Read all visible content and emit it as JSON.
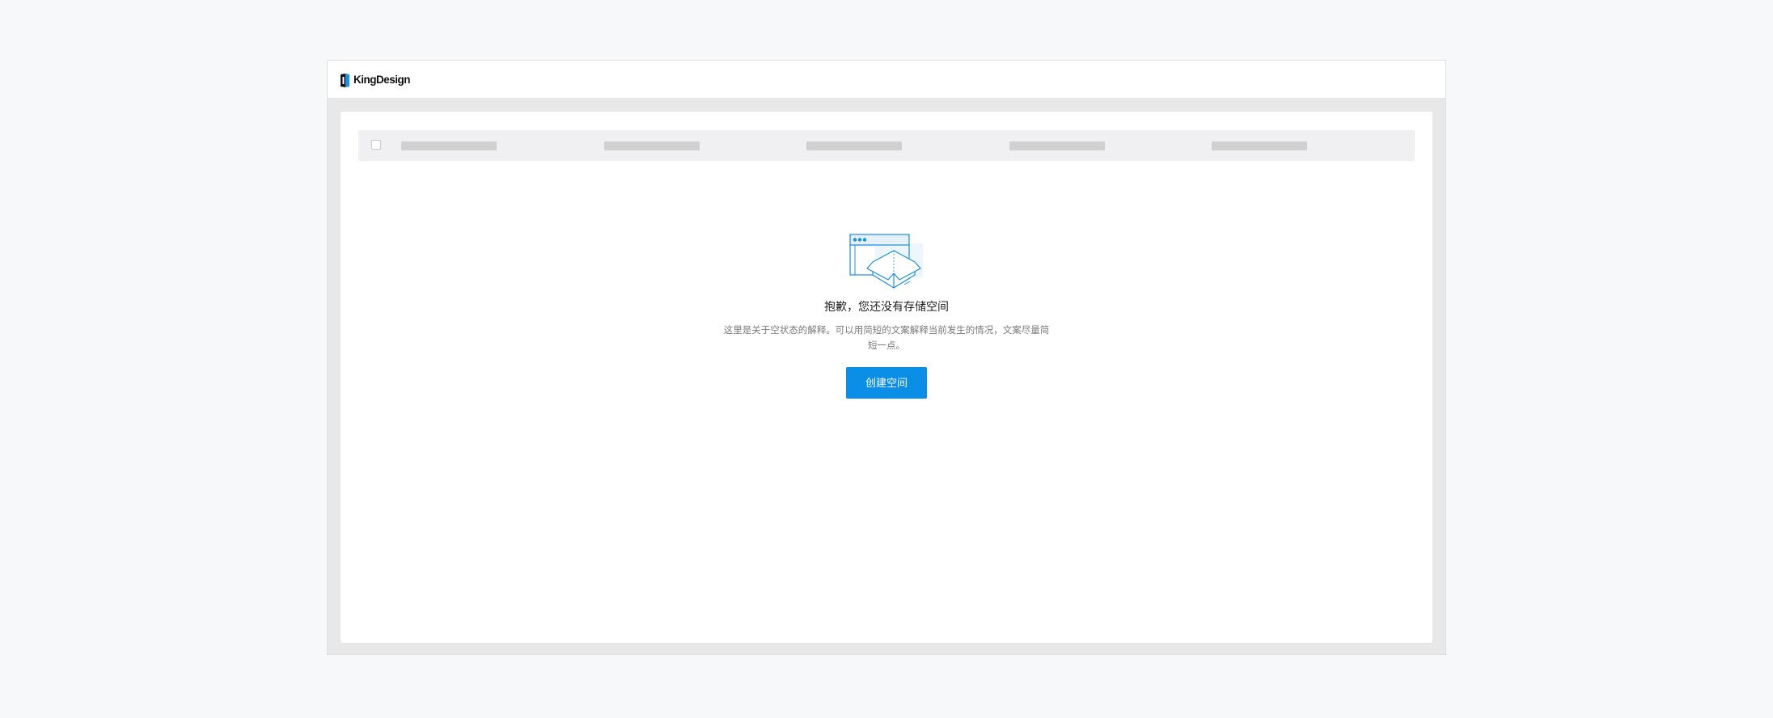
{
  "app": {
    "brand_name": "KingDesign",
    "logo_icon": "kingdesign-logo-icon"
  },
  "table": {
    "header_checkbox": "checkbox",
    "column_placeholders": 5
  },
  "empty_state": {
    "illustration": "empty-box-icon",
    "title": "抱歉，您还没有存储空间",
    "description": "这里是关于空状态的解释。可以用简短的文案解释当前发生的情况，文案尽量简短一点。",
    "button_label": "创建空间"
  },
  "colors": {
    "primary": "#0b8ee6",
    "page_background": "#f7f8fa",
    "frame_background": "#e8e8e8",
    "header_row_background": "#f0f0f3",
    "placeholder_bar": "#d0d0d0",
    "illustration_stroke": "#1a8ee5"
  }
}
